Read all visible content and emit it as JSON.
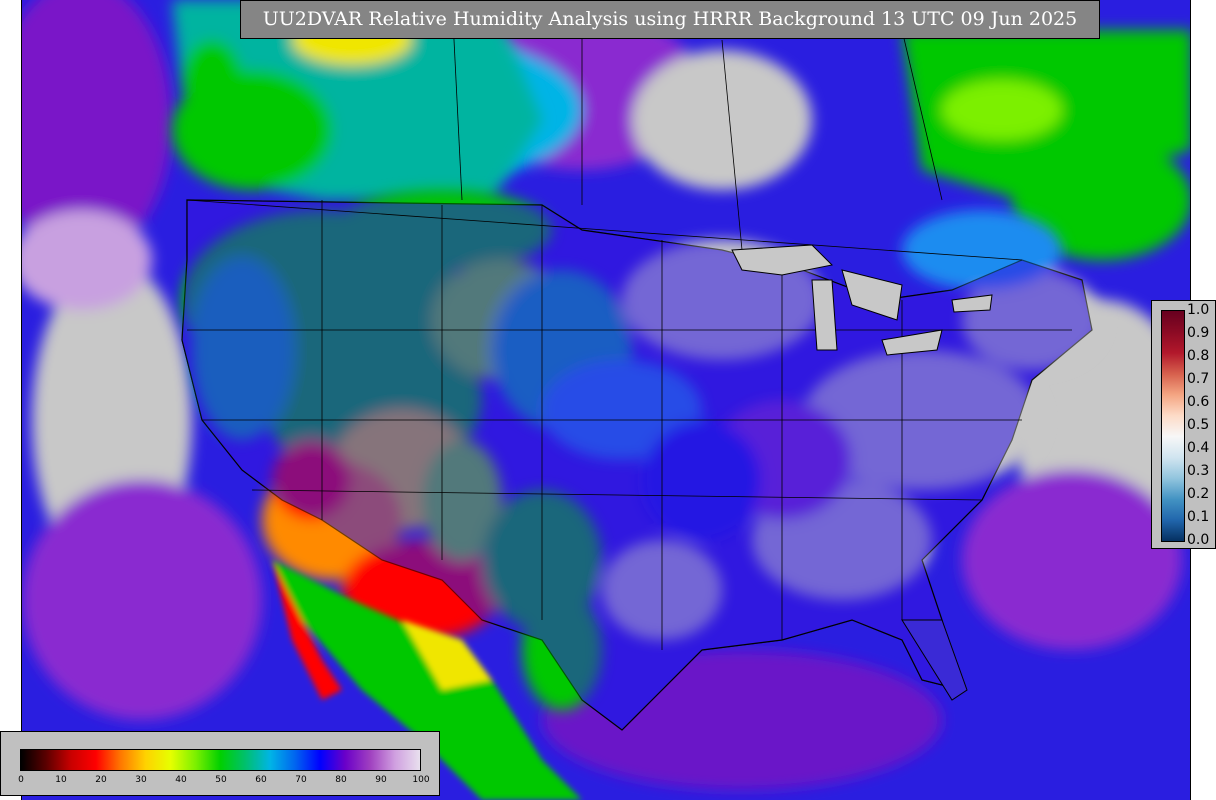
{
  "title": "UU2DVAR Relative Humidity Analysis using HRRR Background 13 UTC 09 Jun 2025",
  "obs_colorbar": {
    "labels": [
      "1.0",
      "0.9",
      "0.8",
      "0.7",
      "0.6",
      "0.5",
      "0.4",
      "0.3",
      "0.2",
      "0.1",
      "0.0"
    ],
    "colors": [
      "#67001f",
      "#8b0a24",
      "#b2182b",
      "#d6604d",
      "#f4a582",
      "#fddbc7",
      "#f7f7f7",
      "#d1e5f0",
      "#92c5de",
      "#4393c3",
      "#2166ac",
      "#053061"
    ]
  },
  "rh_colorbar": {
    "ticks": [
      "0",
      "10",
      "20",
      "30",
      "40",
      "50",
      "60",
      "70",
      "80",
      "90",
      "100"
    ],
    "colors": [
      "#000000",
      "#5a0000",
      "#c80000",
      "#ff0000",
      "#ff7800",
      "#ffd200",
      "#e6ff00",
      "#7cf000",
      "#00d000",
      "#00c06e",
      "#00b4e6",
      "#0064f0",
      "#0000ff",
      "#6a00c8",
      "#a040c0",
      "#d0a0e0",
      "#e8e0ee"
    ]
  },
  "map": {
    "colors": {
      "ocean_deep": "#1a14e8",
      "ocean_purple": "#7a18c8",
      "cloud_gray": "#c8c8c8",
      "very_dry": "#ff0000",
      "dry_orange": "#ff8a00",
      "yellow": "#f0e600",
      "green": "#00c800",
      "teal": "#00b496",
      "blue": "#1e8cf0",
      "land_purple": "#8a2ad0"
    }
  }
}
